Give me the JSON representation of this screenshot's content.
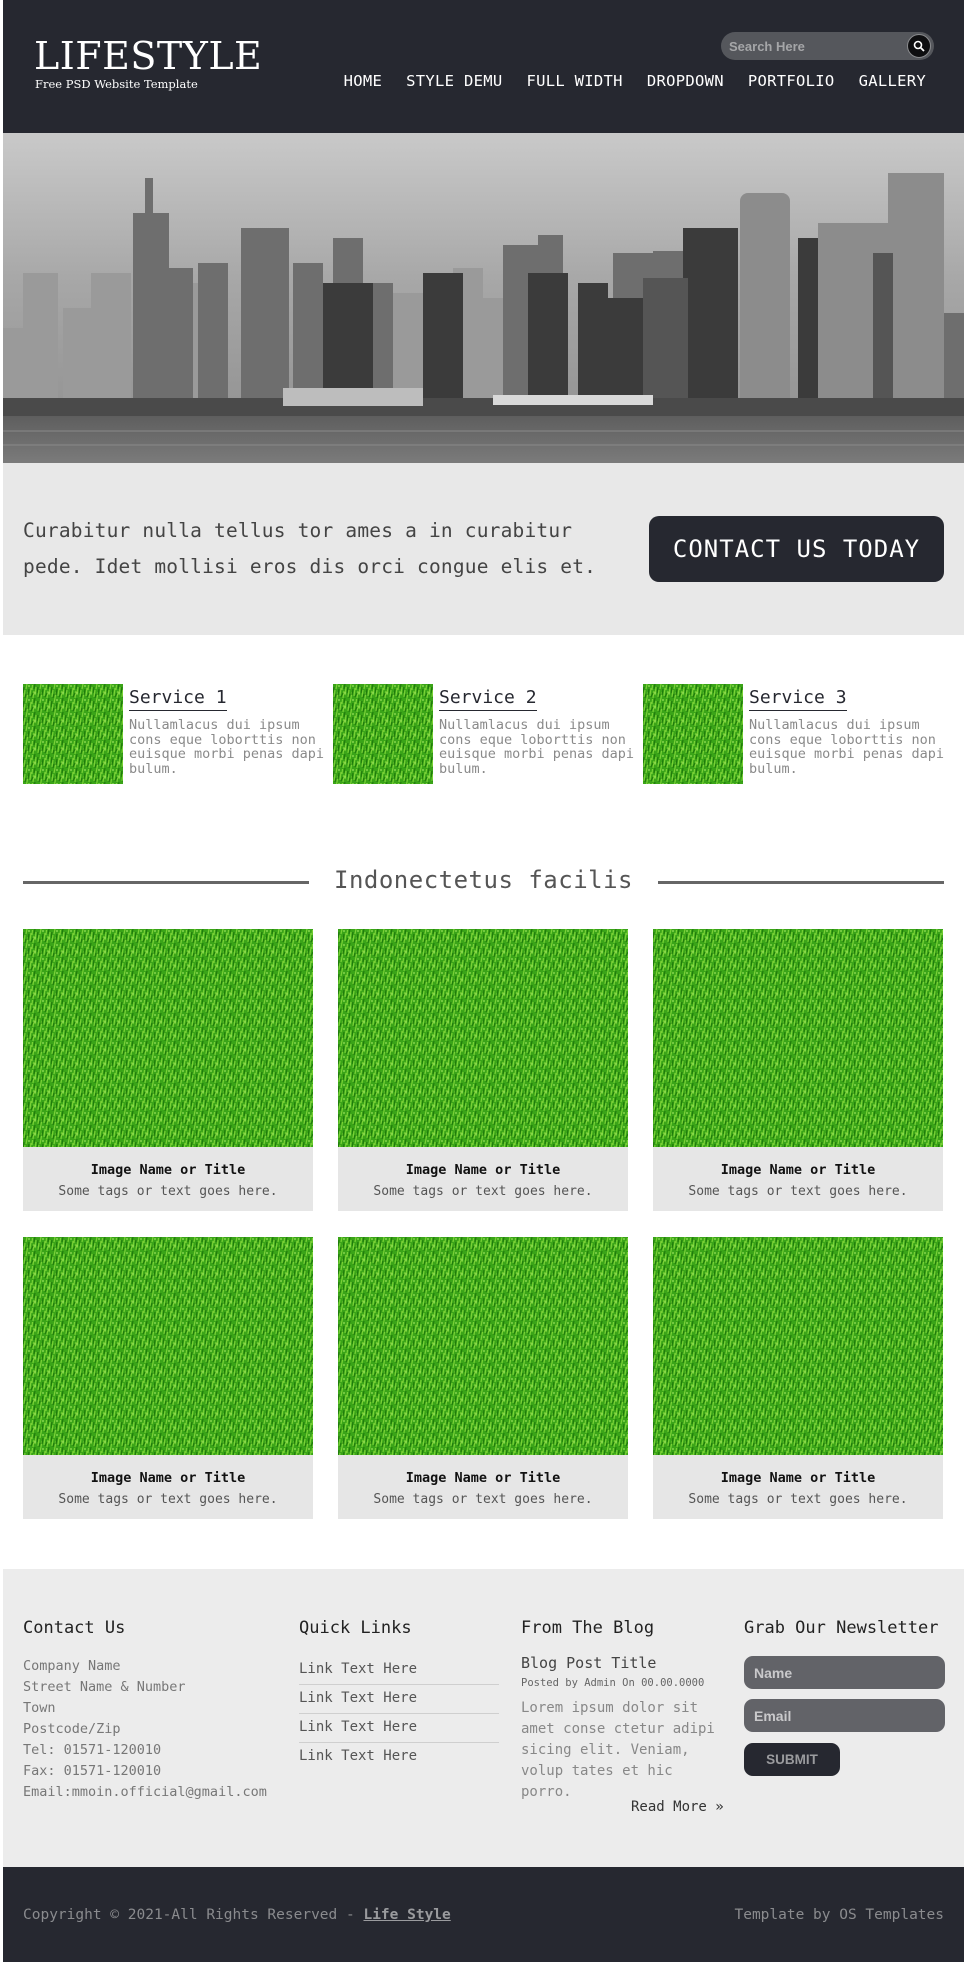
{
  "header": {
    "logo_title": "LIFESTYLE",
    "logo_subtitle": "Free PSD Website Template",
    "search_placeholder": "Search Here",
    "nav": [
      "HOME",
      "STYLE DEMU",
      "FULL WIDTH",
      "DROPDOWN",
      "PORTFOLIO",
      "GALLERY"
    ]
  },
  "callout": {
    "text": "Curabitur nulla tellus tor ames a in curabitur pede. Idet mollisi eros dis orci congue elis et.",
    "button_label": "CONTACT US TODAY"
  },
  "services": [
    {
      "title": "Service 1",
      "text": "Nullamlacus dui ipsum cons eque loborttis non euisque morbi penas dapi bulum."
    },
    {
      "title": "Service 2",
      "text": "Nullamlacus dui ipsum cons eque loborttis non euisque morbi penas dapi bulum."
    },
    {
      "title": "Service 3",
      "text": "Nullamlacus dui ipsum cons eque loborttis non euisque morbi penas dapi bulum."
    }
  ],
  "gallery": {
    "heading": "Indonectetus facilis",
    "items": [
      {
        "title": "Image Name or Title",
        "subtitle": "Some tags or text goes here."
      },
      {
        "title": "Image Name or Title",
        "subtitle": "Some tags or text goes here."
      },
      {
        "title": "Image Name or Title",
        "subtitle": "Some tags or text goes here."
      },
      {
        "title": "Image Name or Title",
        "subtitle": "Some tags or text goes here."
      },
      {
        "title": "Image Name or Title",
        "subtitle": "Some tags or text goes here."
      },
      {
        "title": "Image Name or Title",
        "subtitle": "Some tags or text goes here."
      }
    ]
  },
  "footer": {
    "contact": {
      "heading": "Contact Us",
      "lines": [
        "Company Name",
        "Street Name & Number",
        "Town",
        "Postcode/Zip",
        "Tel: 01571-120010",
        "Fax: 01571-120010",
        "Email:mmoin.official@gmail.com"
      ]
    },
    "quick_links": {
      "heading": "Quick Links",
      "links": [
        "Link Text Here",
        "Link Text Here",
        "Link Text Here",
        "Link Text Here"
      ]
    },
    "blog": {
      "heading": "From The Blog",
      "post_title": "Blog Post Title",
      "post_meta": "Posted by Admin On 00.00.0000",
      "post_body": "Lorem ipsum dolor sit amet conse ctetur adipi sicing elit. Veniam, volup tates et hic porro.",
      "read_more": "Read More »"
    },
    "newsletter": {
      "heading": "Grab Our Newsletter",
      "name_placeholder": "Name",
      "email_placeholder": "Email",
      "submit_label": "SUBMIT"
    }
  },
  "bottom_bar": {
    "copyright_prefix": "Copyright © 2021-All Rights Reserved - ",
    "copyright_link": "Life Style",
    "credit": "Template by OS Templates"
  },
  "colors": {
    "dark": "#262830",
    "light_band": "#e8e8e8",
    "grass": "#3fa91c"
  }
}
